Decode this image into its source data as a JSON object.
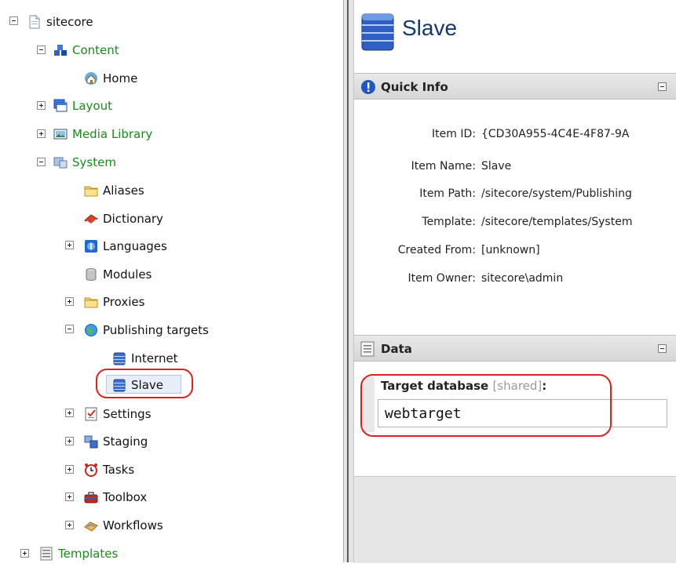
{
  "tree": {
    "root": "sitecore",
    "content": "Content",
    "home": "Home",
    "layout": "Layout",
    "media_library": "Media Library",
    "system": "System",
    "aliases": "Aliases",
    "dictionary": "Dictionary",
    "languages": "Languages",
    "modules": "Modules",
    "proxies": "Proxies",
    "publishing_targets": "Publishing targets",
    "internet": "Internet",
    "slave": "Slave",
    "settings": "Settings",
    "staging": "Staging",
    "tasks": "Tasks",
    "toolbox": "Toolbox",
    "workflows": "Workflows",
    "templates": "Templates"
  },
  "item": {
    "title": "Slave"
  },
  "quick_info": {
    "title": "Quick Info",
    "item_id_label": "Item ID:",
    "item_id": "{CD30A955-4C4E-4F87-9A",
    "item_name_label": "Item Name:",
    "item_name": "Slave",
    "item_path_label": "Item Path:",
    "item_path": "/sitecore/system/Publishing",
    "template_label": "Template:",
    "template": "/sitecore/templates/System",
    "created_from_label": "Created From:",
    "created_from": "[unknown]",
    "item_owner_label": "Item Owner:",
    "item_owner": "sitecore\\admin"
  },
  "data_section": {
    "title": "Data",
    "field_label": "Target database",
    "field_shared": "[shared]",
    "field_colon": ":",
    "field_value": "webtarget"
  },
  "colors": {
    "tree_green": "#1a8a1a",
    "title_blue": "#15376e",
    "highlight_red": "#e02020"
  }
}
